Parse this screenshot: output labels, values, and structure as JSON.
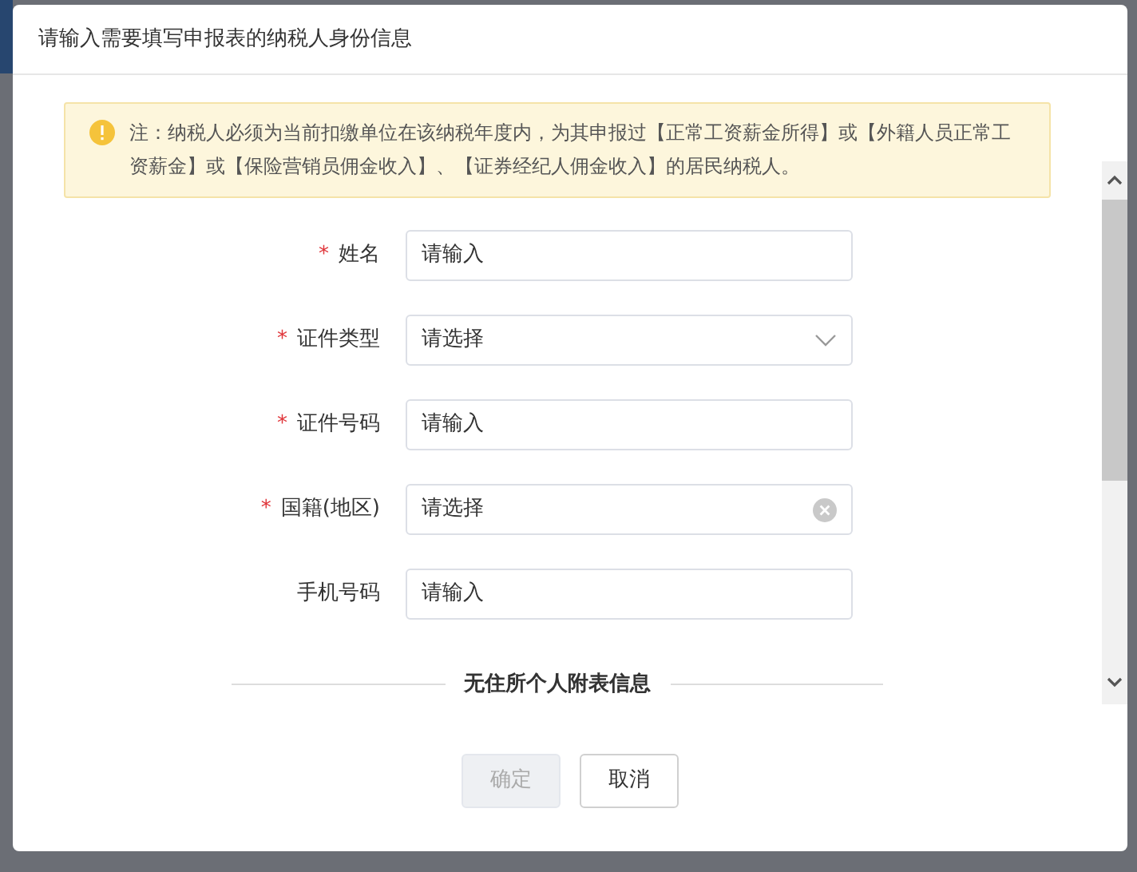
{
  "dialog": {
    "title": "请输入需要填写申报表的纳税人身份信息"
  },
  "notice": {
    "text": "注：纳税人必须为当前扣缴单位在该纳税年度内，为其申报过【正常工资薪金所得】或【外籍人员正常工资薪金】或【保险营销员佣金收入】、【证券经纪人佣金收入】的居民纳税人。"
  },
  "fields": [
    {
      "required_mark": "*",
      "label": "姓名",
      "kind": "input",
      "placeholder": "请输入"
    },
    {
      "required_mark": "*",
      "label": "证件类型",
      "kind": "select",
      "placeholder": "请选择"
    },
    {
      "required_mark": "*",
      "label": "证件号码",
      "kind": "input",
      "placeholder": "请输入"
    },
    {
      "required_mark": "*",
      "label": "国籍(地区)",
      "kind": "clearable",
      "placeholder": "请选择"
    },
    {
      "label": "手机号码",
      "kind": "input",
      "placeholder": "请输入"
    }
  ],
  "section": {
    "title": "无住所个人附表信息"
  },
  "buttons": [
    {
      "label": "确定",
      "disabled": true
    },
    {
      "label": "取消",
      "disabled": false
    }
  ]
}
